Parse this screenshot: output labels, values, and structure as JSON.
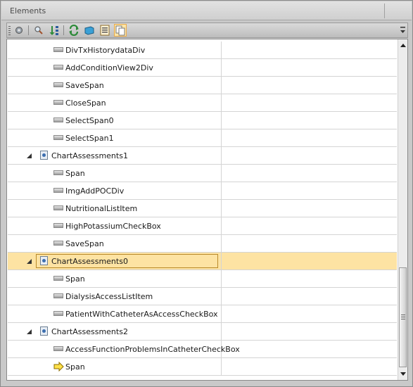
{
  "window": {
    "title": "Elements"
  },
  "toolbar": {
    "buttons": [
      {
        "icon": "settings-gear-icon"
      },
      {
        "icon": "search-icon"
      },
      {
        "icon": "sort-descending-icon"
      },
      {
        "icon": "refresh-icon"
      },
      {
        "icon": "object-store-icon"
      },
      {
        "icon": "list-view-icon"
      },
      {
        "icon": "copy-icon"
      }
    ]
  },
  "rows": [
    {
      "kind": "leaf",
      "label": "DivTxHistorydataDiv"
    },
    {
      "kind": "leaf",
      "label": "AddConditionView2Div"
    },
    {
      "kind": "leaf",
      "label": "SaveSpan"
    },
    {
      "kind": "leaf",
      "label": "CloseSpan"
    },
    {
      "kind": "leaf",
      "label": "SelectSpan0"
    },
    {
      "kind": "leaf",
      "label": "SelectSpan1"
    },
    {
      "kind": "node",
      "label": "ChartAssessments1"
    },
    {
      "kind": "leaf",
      "label": "Span"
    },
    {
      "kind": "leaf",
      "label": "ImgAddPOCDiv"
    },
    {
      "kind": "leaf",
      "label": "NutritionalListItem"
    },
    {
      "kind": "leaf",
      "label": "HighPotassiumCheckBox"
    },
    {
      "kind": "leaf",
      "label": "SaveSpan"
    },
    {
      "kind": "node",
      "label": "ChartAssessments0",
      "selected": true
    },
    {
      "kind": "leaf",
      "label": "Span"
    },
    {
      "kind": "leaf",
      "label": "DialysisAccessListItem"
    },
    {
      "kind": "leaf",
      "label": "PatientWithCatheterAsAccessCheckBox"
    },
    {
      "kind": "node",
      "label": "ChartAssessments2"
    },
    {
      "kind": "leaf",
      "label": "AccessFunctionProblemsInCatheterCheckBox"
    },
    {
      "kind": "leaf",
      "label": "Span",
      "icon": "current-arrow-icon"
    }
  ],
  "colors": {
    "selected_row": "#fde3a3",
    "selected_border": "#b98a2a"
  }
}
